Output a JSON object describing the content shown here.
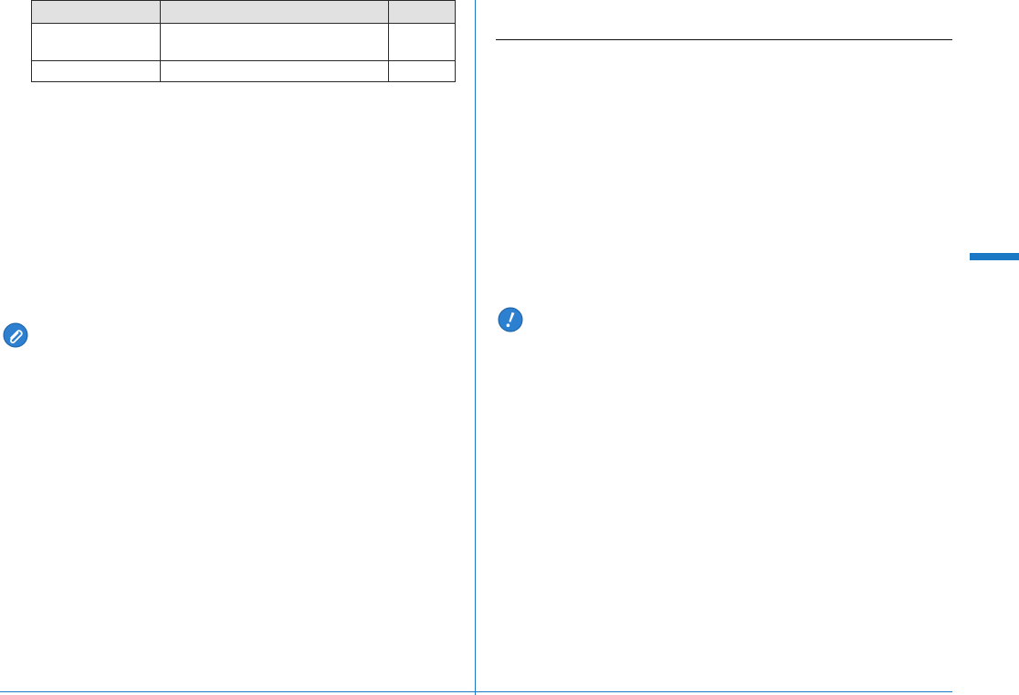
{
  "table": {
    "header_cells": [
      "",
      "",
      ""
    ],
    "rows": [
      [
        "",
        "",
        ""
      ],
      [
        "",
        "",
        ""
      ]
    ]
  },
  "icons": {
    "memo": "paperclip-memo-icon",
    "caution": "exclamation-caution-icon"
  },
  "colors": {
    "accent": "#1b78c5",
    "icon_fill": "#2d7fd0",
    "table_header": "#e1e1e1",
    "rule": "#111111"
  }
}
